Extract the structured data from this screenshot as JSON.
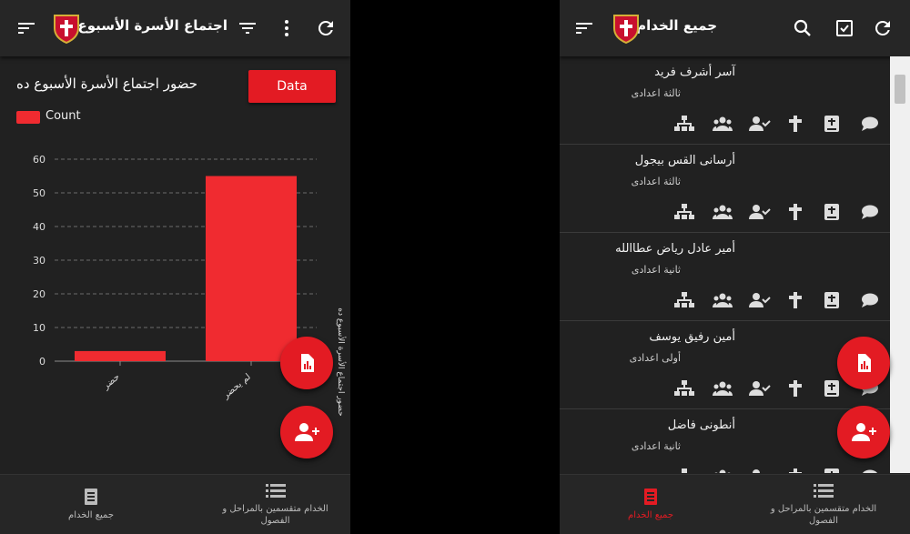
{
  "left": {
    "title": "اجتماع الأسرة الأسبوع ده",
    "chart_title": "حضور اجتماع الأسرة الأسبوع ده",
    "data_button": "Data",
    "legend_label": "Count",
    "side_label": "حضور اجتماع الأسرة الأسبوع ده",
    "nav": {
      "servants_label": "الخدام متقسمين بالمراحل و الفصول",
      "all_label": "جميع الخدام"
    }
  },
  "right": {
    "title": "جميع الخدام",
    "items": [
      {
        "name": "آسر أشرف فريد",
        "grade": "ثالثة اعدادى"
      },
      {
        "name": "أرسانى القس بيجول",
        "grade": "ثالثة اعدادى"
      },
      {
        "name": "أمير عادل رياض عطاالله",
        "grade": "ثانية اعدادى"
      },
      {
        "name": "أمين رفيق يوسف",
        "grade": "أولى اعدادى"
      },
      {
        "name": "أنطونى فاضل",
        "grade": "ثانية اعدادى"
      }
    ],
    "nav": {
      "all_label": "جميع الخدام",
      "servants_label": "الخدام متقسمين بالمراحل و الفصول"
    }
  },
  "colors": {
    "accent": "#e31b23",
    "bar": "#f02b30",
    "background": "#212121",
    "appbar": "#262626"
  },
  "chart_data": {
    "type": "bar",
    "categories": [
      "حضر",
      "لم يحضر"
    ],
    "series": [
      {
        "name": "Count",
        "values": [
          3,
          55
        ]
      }
    ],
    "title": "حضور اجتماع الأسرة الأسبوع ده",
    "ylim": [
      0,
      60
    ],
    "yticks": [
      0,
      10,
      20,
      30,
      40,
      50,
      60
    ],
    "grid": true,
    "legend": "top-left"
  }
}
